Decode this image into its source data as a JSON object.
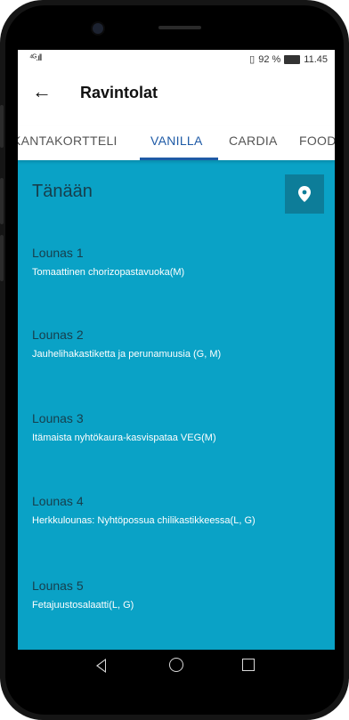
{
  "statusbar": {
    "signal": "⁴ᴳ.ıll",
    "vibrate_icon": "vibrate-icon",
    "battery_text": "92 %",
    "time": "11.45"
  },
  "appbar": {
    "back_icon": "arrow-left-icon",
    "title": "Ravintolat"
  },
  "tabs": [
    {
      "label": "KANTAKORTTELI"
    },
    {
      "label": "VANILLA"
    },
    {
      "label": "CARDIA"
    },
    {
      "label": "FOOD"
    }
  ],
  "active_tab": "VANILLA",
  "content": {
    "section_title": "Tänään",
    "map_icon": "map-pin-icon",
    "background_color": "#0aa2c6",
    "meals": [
      {
        "title": "Lounas 1",
        "desc": "Tomaattinen chorizopastavuoka(M)"
      },
      {
        "title": "Lounas 2",
        "desc": "Jauhelihakastiketta ja perunamuusia (G, M)"
      },
      {
        "title": "Lounas 3",
        "desc": "Itämaista nyhtökaura-kasvispataa VEG(M)"
      },
      {
        "title": "Lounas 4",
        "desc": "Herkkulounas: Nyhtöpossua chilikastikkeessa(L, G)"
      },
      {
        "title": "Lounas 5",
        "desc": "Fetajuustosalaatti(L, G)"
      }
    ]
  },
  "colors": {
    "accent": "#1e5aa6",
    "map_button": "#0d7d99",
    "title_text": "#173e4c"
  },
  "navbar": {
    "back_icon": "nav-back-triangle-icon",
    "home_icon": "nav-home-circle-icon",
    "recent_icon": "nav-recent-square-icon"
  }
}
